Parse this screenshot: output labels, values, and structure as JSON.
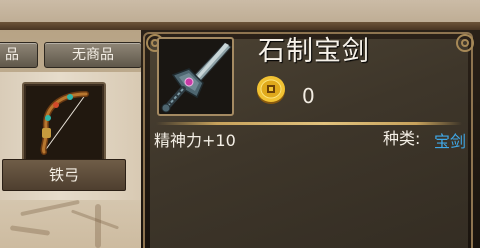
{
  "shop_tabs": {
    "goods_label": "品",
    "no_goods_label": "无商品"
  },
  "inventory": {
    "selected_item_name": "铁弓",
    "selected_item_icon": "bow-icon"
  },
  "detail": {
    "item_name": "石制宝剑",
    "item_icon": "stone-sword-icon",
    "currency_icon": "gold-coin-icon",
    "price": "0",
    "stat": "精神力+10",
    "type_label": "种类:",
    "type_value": "宝剑"
  },
  "colors": {
    "type_value": "#3fa8e8",
    "divider_gold": "#e2c37e",
    "frame_border": "#8e7450"
  }
}
